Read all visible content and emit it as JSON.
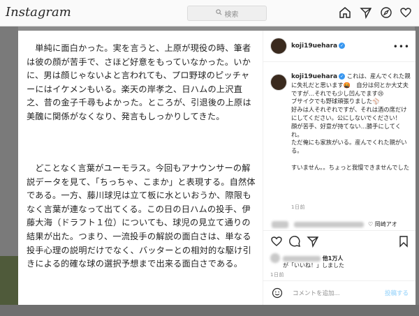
{
  "topbar": {
    "logo": "Instagram",
    "search_placeholder": "検索"
  },
  "article": {
    "paragraph1": "単純に面白かった。実を言うと、上原が現役の時、筆者は彼の顔が苦手で、さほど好意をもっていなかった。いかに、男は顔じゃないよと言われても、プロ野球のピッチャーにはイケメンもいる。楽天の岸孝之、日ハムの上沢直之、昔の金子千尋もよかった。ところが、引退後の上原は美醜に関係がなくなり、発言もしっかりしてきた。",
    "paragraph2": "どことなく言葉がユーモラス。今回もアナウンサーの解説データを見て、「ちっちゃ、こまか」と表現する。自然体である。一方、藤川球児は立て板に水といおうか、際限もなく言葉が連なって出てくる。この日の日ハムの投手、伊藤大海（ドラフト１位）についても、球児の見立て通りの結果が出た。つまり、一流投手の解説の面白さは、単なる投手心理の説明だけでなく、バッターとの相対的な駆け引きによる的確な球の選択予想まで出来る面白さである。"
  },
  "post": {
    "username": "koji19uehara",
    "caption_lines": [
      "これは、産んでくれた親に失礼だと思います🤬　自分は何とか大丈夫ですが…それでも少し凹んでます😢",
      "ブサイクでも野球頑張りました⚾",
      "好みは人それぞれですが、それは酒の席だけにしてください。公にしないでください！",
      "顔が苦手、好意が持てない…勝手にしてくれ。",
      "ただ俺にも家族がいる。産んでくれた親がいる。",
      "",
      "すいません。。ちょっと我慢できませんでした"
    ],
    "time": "1日前",
    "likes": "他1万人",
    "likes_suffix": "が「いいね！」しました",
    "posted_time": "1日前",
    "add_comment_placeholder": "コメントを追加...",
    "post_button": "投稿する",
    "blurred_comment_text": "岡崎アオ"
  },
  "colors": {
    "accent": "#3897f0",
    "post_button": "#b2dffc"
  }
}
